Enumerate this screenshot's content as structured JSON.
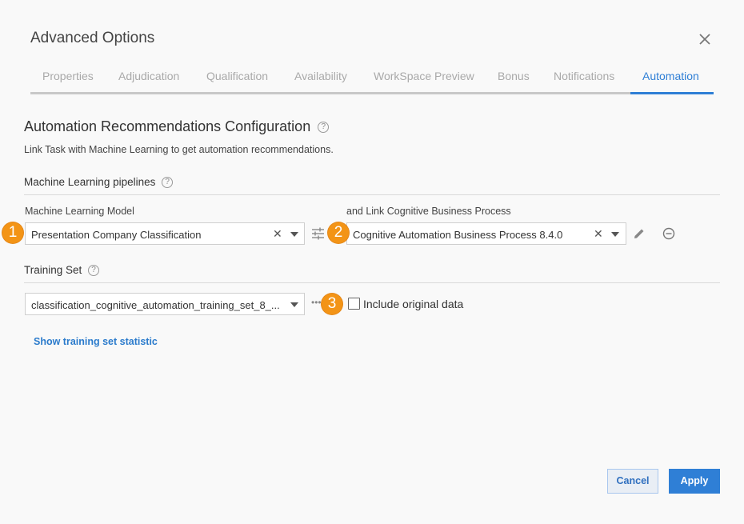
{
  "dialog": {
    "title": "Advanced Options"
  },
  "tabs": [
    {
      "label": "Properties"
    },
    {
      "label": "Adjudication"
    },
    {
      "label": "Qualification"
    },
    {
      "label": "Availability"
    },
    {
      "label": "WorkSpace Preview"
    },
    {
      "label": "Bonus"
    },
    {
      "label": "Notifications"
    },
    {
      "label": "Automation",
      "active": true
    }
  ],
  "main": {
    "heading": "Automation Recommendations Configuration",
    "description": "Link Task with Machine Learning to get automation recommendations.",
    "pipelines": {
      "heading": "Machine Learning pipelines",
      "model_label": "Machine Learning Model",
      "model_value": "Presentation Company Classification",
      "process_label": "and Link Cognitive Business Process",
      "process_value": "Cognitive Automation Business Process 8.4.0"
    },
    "training": {
      "heading": "Training Set",
      "value": "classification_cognitive_automation_training_set_8_...",
      "include_label": "Include original data",
      "include_checked": false,
      "show_stats_link": "Show training set statistic"
    }
  },
  "badges": [
    "1",
    "2",
    "3"
  ],
  "footer": {
    "cancel_label": "Cancel",
    "apply_label": "Apply"
  },
  "colors": {
    "accent": "#2f7fd6",
    "badge": "#f39416"
  }
}
